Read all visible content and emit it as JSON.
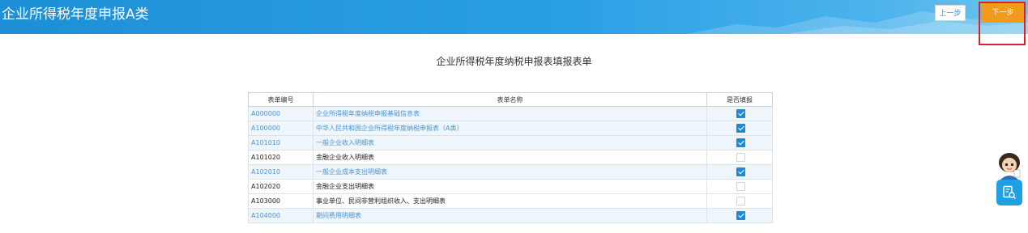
{
  "header": {
    "title": "企业所得税年度申报A类",
    "prev_label": "上一步",
    "next_label": "下一步"
  },
  "page_title": "企业所得税年度纳税申报表填报表单",
  "table": {
    "columns": [
      "表单编号",
      "表单名称",
      "是否填报"
    ],
    "rows": [
      {
        "code": "A000000",
        "name": "企业所得税年度纳税申报基础信息表",
        "filled": true
      },
      {
        "code": "A100000",
        "name": "中华人民共和国企业所得税年度纳税申报表（A类）",
        "filled": true
      },
      {
        "code": "A101010",
        "name": "一般企业收入明细表",
        "filled": true
      },
      {
        "code": "A101020",
        "name": "金融企业收入明细表",
        "filled": false
      },
      {
        "code": "A102010",
        "name": "一般企业成本支出明细表",
        "filled": true
      },
      {
        "code": "A102020",
        "name": "金融企业支出明细表",
        "filled": false
      },
      {
        "code": "A103000",
        "name": "事业单位、民间非营利组织收入、支出明细表",
        "filled": false
      },
      {
        "code": "A104000",
        "name": "期间费用明细表",
        "filled": true
      }
    ]
  },
  "colors": {
    "header_blue": "#2b9fe4",
    "next_orange": "#f29a1b",
    "highlight_red": "#d8232a",
    "checkbox_blue": "#1b8ad8"
  },
  "icons": {
    "assistant": "tax-assistant-avatar-icon",
    "side_tool": "document-search-icon"
  }
}
